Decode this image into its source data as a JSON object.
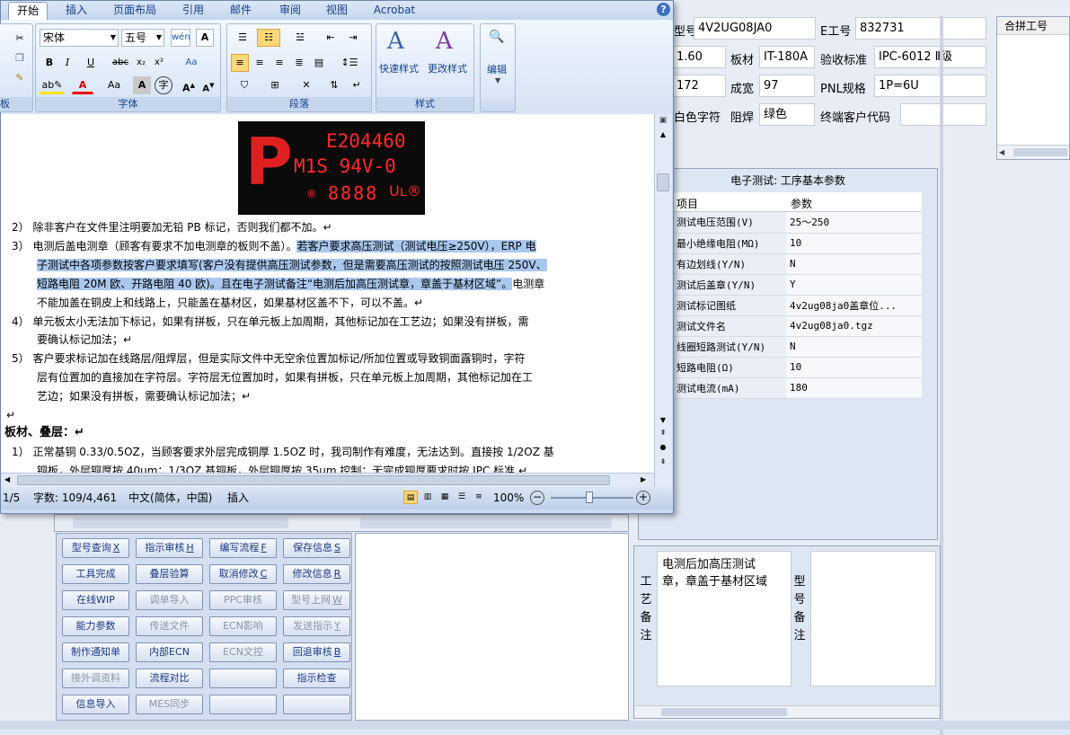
{
  "erp": {
    "fields": {
      "model_label": "型号",
      "model_value": "4V2UG08JA0",
      "eno_label": "E工号",
      "eno_value": "832731",
      "thickness_value": "1.60",
      "material_label": "板材",
      "material_value": "IT-180A",
      "standard_label": "验收标准",
      "standard_value": "IPC-6012 Ⅱ级",
      "row3_value": "172",
      "yield_label": "成宽",
      "yield_value": "97",
      "pnl_label": "PNL规格",
      "pnl_value": "1P=6U",
      "silk_label": "白色字符",
      "mask_label": "阻焊",
      "mask_value": "绿色",
      "customer_code_label": "终端客户代码",
      "customer_code_value": ""
    },
    "merge_header": "合拼工号",
    "etest": {
      "title": "电子测试: 工序基本参数",
      "col_item": "项目",
      "col_param": "参数",
      "rows": [
        {
          "item": "测试电压范围(V)",
          "param": "25～250"
        },
        {
          "item": "最小绝缘电阻(MΩ)",
          "param": "10"
        },
        {
          "item": "有边划线(Y/N)",
          "param": "N"
        },
        {
          "item": "测试后盖章(Y/N)",
          "param": "Y"
        },
        {
          "item": "测试标记图纸",
          "param": "4v2ug08ja0盖章位..."
        },
        {
          "item": "测试文件名",
          "param": "4v2ug08ja0.tgz"
        },
        {
          "item": "线圈短路测试(Y/N)",
          "param": "N"
        },
        {
          "item": "短路电阻(Ω)",
          "param": "10"
        },
        {
          "item": "测试电流(mA)",
          "param": "180"
        }
      ]
    },
    "remark_craft_label": "工艺备注",
    "remark_craft_text": "电测后加高压测试章，章盖于基材区域",
    "remark_model_label": "型号备注",
    "buttons": [
      {
        "label": "型号查询",
        "key": "X",
        "enabled": true
      },
      {
        "label": "指示审核",
        "key": "H",
        "enabled": true
      },
      {
        "label": "编写流程",
        "key": "F",
        "enabled": true
      },
      {
        "label": "保存信息",
        "key": "S",
        "enabled": true
      },
      {
        "label": "工具完成",
        "key": "",
        "enabled": true
      },
      {
        "label": "叠层验算",
        "key": "",
        "enabled": true
      },
      {
        "label": "取消修改",
        "key": "C",
        "enabled": true
      },
      {
        "label": "修改信息",
        "key": "R",
        "enabled": true
      },
      {
        "label": "在线WIP",
        "key": "",
        "enabled": true
      },
      {
        "label": "调单导入",
        "key": "",
        "enabled": false
      },
      {
        "label": "PPC审核",
        "key": "",
        "enabled": false
      },
      {
        "label": "型号上网",
        "key": "W",
        "enabled": false
      },
      {
        "label": "能力参数",
        "key": "",
        "enabled": true
      },
      {
        "label": "传送文件",
        "key": "",
        "enabled": false
      },
      {
        "label": "ECN影响",
        "key": "",
        "enabled": false
      },
      {
        "label": "发送指示",
        "key": "Y",
        "enabled": false
      },
      {
        "label": "制作通知单",
        "key": "",
        "enabled": true
      },
      {
        "label": "内部ECN",
        "key": "",
        "enabled": true
      },
      {
        "label": "ECN文控",
        "key": "",
        "enabled": false
      },
      {
        "label": "回退审核",
        "key": "B",
        "enabled": true
      },
      {
        "label": "接外调资料",
        "key": "",
        "enabled": false
      },
      {
        "label": "流程对比",
        "key": "",
        "enabled": true
      },
      {
        "label": "",
        "key": "",
        "enabled": true
      },
      {
        "label": "指示检查",
        "key": "",
        "enabled": true
      },
      {
        "label": "信息导入",
        "key": "",
        "enabled": true
      },
      {
        "label": "MES同步",
        "key": "",
        "enabled": false
      },
      {
        "label": "",
        "key": "",
        "enabled": true
      },
      {
        "label": "",
        "key": "",
        "enabled": true
      }
    ]
  },
  "word": {
    "tabs": [
      "开始",
      "插入",
      "页面布局",
      "引用",
      "邮件",
      "审阅",
      "视图",
      "Acrobat"
    ],
    "active_tab": "开始",
    "font_name": "宋体",
    "font_size": "五号",
    "group_labels": [
      "板",
      "字体",
      "段落",
      "样式"
    ],
    "quick_style_label": "快速样式",
    "change_style_label": "更改样式",
    "edit_label": "编辑",
    "ul_logo": {
      "line1": "E204460",
      "line2": "M1S 94V-0",
      "line3": "8888"
    },
    "lines": [
      "2） 除非客户在文件里注明要加无铅 PB 标记，否则我们都不加。↵",
      "3） 电测后盖电测章（顾客有要求不加电测章的板则不盖）。",
      "若客户要求高压测试（测试电压≥250V），ERP 电",
      "子测试中各项参数按客户要求填写(客户没有提供高压测试参数，但是需要高压测试的按照测试电压 250V、",
      "短路电阻 20M 欧、开路电阻 40 欧)。且在电子测试备注“电测后加高压测试章，章盖于基材区域”。",
      "电测章",
      "不能加盖在铜皮上和线路上，只能盖在基材区，如果基材区盖不下，可以不盖。↵",
      "4） 单元板太小无法加下标记，如果有拼板，只在单元板上加周期，其他标记加在工艺边；如果没有拼板，需",
      "要确认标记加法；↵",
      "5） 客户要求标记加在线路层/阻焊层，但是实际文件中无空余位置加标记/所加位置或导致铜面露铜时，字符",
      "层有位置加的直接加在字符层。字符层无位置加时，如果有拼板，只在单元板上加周期，其他标记加在工",
      "艺边；如果没有拼板，需要确认标记加法；↵",
      "↵",
      "板材、叠层：↵",
      "1） 正常基铜 0.33/0.5OZ，当顾客要求外层完成铜厚 1.5OZ 时，我司制作有难度，无法达到。直接按 1/2OZ 基",
      "铜板，外层铜厚按 40um；1/3OZ 基铜板，外层铜厚按 35um 控制；无完成铜厚要求时按 IPC 标准 ↵"
    ],
    "status": {
      "page": "1/5",
      "word_count": "字数: 109/4,461",
      "language": "中文(简体，中国)",
      "mode": "插入",
      "zoom": "100%"
    }
  }
}
